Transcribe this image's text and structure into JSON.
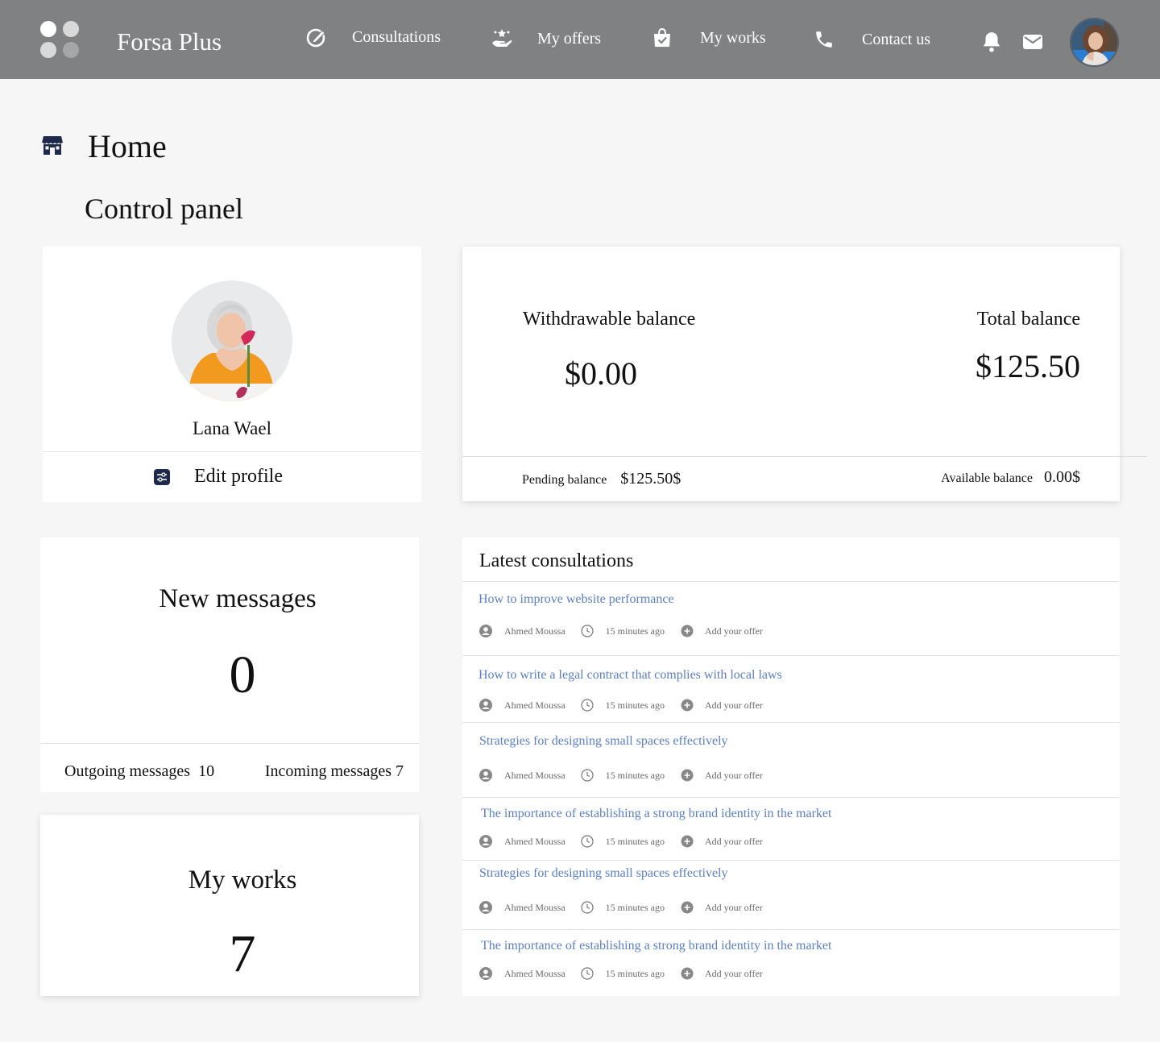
{
  "app": {
    "brand": "Forsa Plus"
  },
  "nav": {
    "consultations": "Consultations",
    "offers": "My offers",
    "works": "My works",
    "contact": "Contact us"
  },
  "icons": {
    "consultations": "pen-circle-icon",
    "offers": "hand-star-icon",
    "works": "shopping-bag-check-icon",
    "contact": "phone-icon",
    "notifications": "bell-icon",
    "messages": "envelope-icon",
    "home": "store-icon",
    "edit_profile": "sliders-icon",
    "author": "user-circle-icon",
    "time": "clock-icon",
    "add": "plus-circle-icon"
  },
  "colors": {
    "navbar": "#808183",
    "link": "#5a7fc4",
    "background": "#f6f6f6",
    "icon_dark": "#1f2a4a"
  },
  "page": {
    "title": "Home",
    "section": "Control panel"
  },
  "profile": {
    "name": "Lana Wael",
    "edit_label": "Edit profile"
  },
  "balance": {
    "withdrawable_label": "Withdrawable balance",
    "withdrawable_value": "$0.00",
    "total_label": "Total balance",
    "total_value": "$125.50",
    "pending_label": "Pending balance",
    "pending_value": "$125.50$",
    "available_label": "Available balance",
    "available_value": "0.00$"
  },
  "messages": {
    "title": "New messages",
    "count": "0",
    "outgoing_label": "Outgoing messages",
    "outgoing_count": "10",
    "incoming_label": "Incoming messages",
    "incoming_count": "7"
  },
  "works": {
    "title": "My works",
    "count": "7"
  },
  "consultations": {
    "title": "Latest consultations",
    "items": [
      {
        "question": "How to improve website performance",
        "author": "Ahmed Moussa",
        "time": "15 minutes ago",
        "action": "Add your offer"
      },
      {
        "question": "How to write a legal contract that complies with local laws",
        "author": "Ahmed Moussa",
        "time": "15 minutes ago",
        "action": "Add your offer"
      },
      {
        "question": "Strategies for designing small spaces effectively",
        "author": "Ahmed Moussa",
        "time": "15 minutes ago",
        "action": "Add your offer"
      },
      {
        "question": "The importance of establishing a strong brand identity in the market",
        "author": "Ahmed Moussa",
        "time": "15 minutes ago",
        "action": "Add your offer"
      },
      {
        "question": "Strategies for designing small spaces effectively",
        "author": "Ahmed Moussa",
        "time": "15 minutes ago",
        "action": "Add your offer"
      },
      {
        "question": "The importance of establishing a strong brand identity in the market",
        "author": "Ahmed Moussa",
        "time": "15 minutes ago",
        "action": "Add your offer"
      }
    ]
  }
}
